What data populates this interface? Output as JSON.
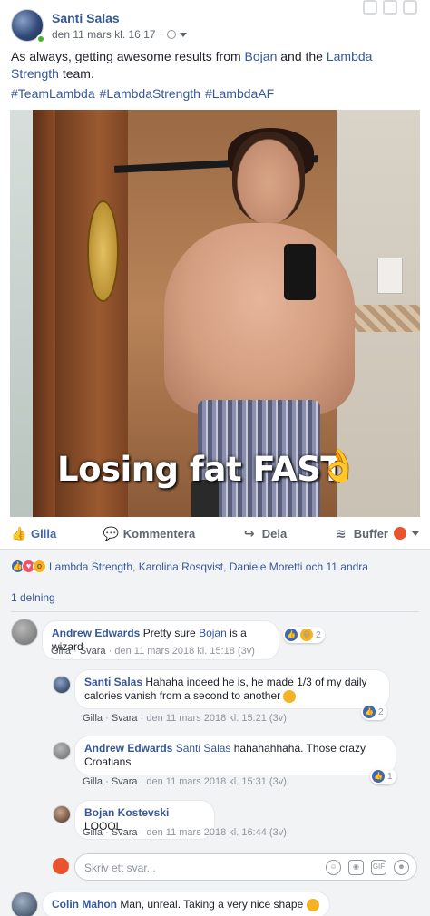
{
  "post": {
    "author": "Santi Salas",
    "date": "den 11 mars kl. 16:17",
    "separator": "·",
    "text_before_1": "As always, getting awesome results from ",
    "mention_1": "Bojan",
    "text_between": " and the ",
    "mention_2": "Lambda Strength",
    "text_after": " team.",
    "hashtags": [
      "#TeamLambda",
      "#LambdaStrength",
      "#LambdaAF"
    ],
    "photo_caption": "Losing fat FAST",
    "photo_emoji": "👌"
  },
  "actions": {
    "like": "Gilla",
    "comment": "Kommentera",
    "share": "Dela",
    "buffer": "Buffer"
  },
  "reactions": {
    "summary": "Lambda Strength, Karolina Rosqvist, Daniele Moretti och 11 andra",
    "shares": "1 delning"
  },
  "comments": [
    {
      "name": "Andrew Edwards",
      "text_before": "Pretty sure ",
      "link": "Bojan",
      "text_after": " is a wizard",
      "like": "Gilla",
      "reply": "Svara",
      "dot": "·",
      "time": "den 11 mars 2018 kl. 15:18 (3v)",
      "reaction_count": "2"
    },
    {
      "name": "Santi Salas",
      "text": "Hahaha indeed he is, he made 1/3 of my daily calories vanish from a second to another",
      "like": "Gilla",
      "reply": "Svara",
      "dot": "·",
      "time": "den 11 mars 2018 kl. 15:21 (3v)",
      "reaction_count": "2"
    },
    {
      "name": "Andrew Edwards",
      "link": "Santi Salas",
      "text_after": " hahahahhaha. Those crazy Croatians",
      "like": "Gilla",
      "reply": "Svara",
      "dot": "·",
      "time": "den 11 mars 2018 kl. 15:31 (3v)",
      "reaction_count": "1"
    },
    {
      "name": "Bojan Kostevski",
      "text": "LOOOL",
      "like": "Gilla",
      "reply": "Svara",
      "dot": "·",
      "time": "den 11 mars 2018 kl. 16:44 (3v)"
    },
    {
      "name": "Colin Mahon",
      "text": "Man, unreal. Taking a very nice shape"
    }
  ],
  "reply_box": {
    "placeholder": "Skriv ett svar...",
    "gif": "GIF"
  },
  "colors": {
    "link": "#365899",
    "like_blue": "#4267b2",
    "background": "#f2f3f5"
  }
}
